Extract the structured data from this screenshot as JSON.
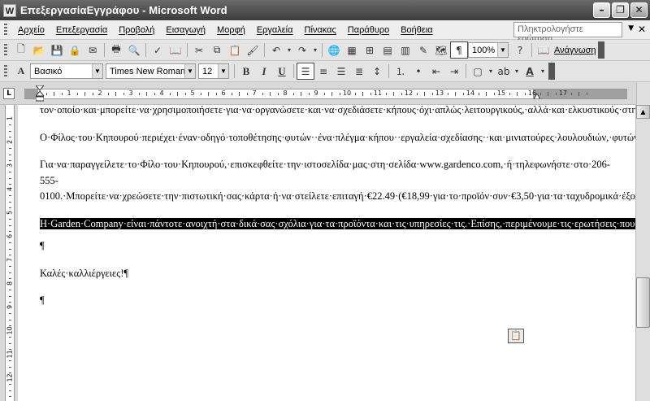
{
  "window": {
    "title": "ΕπεξεργασίαΕγγράφου - Microsoft Word",
    "app_icon_letter": "W"
  },
  "menubar": {
    "items": [
      "Αρχείο",
      "Επεξεργασία",
      "Προβολή",
      "Εισαγωγή",
      "Μορφή",
      "Εργαλεία",
      "Πίνακας",
      "Παράθυρο",
      "Βοήθεια"
    ],
    "ask_placeholder": "Πληκτρολογήστε ερώτηση"
  },
  "standard_toolbar": {
    "zoom": "100%",
    "reading_label": "Ανάγνωση"
  },
  "formatting_toolbar": {
    "style": "Βασικό",
    "font": "Times New Roman",
    "size": "12"
  },
  "ruler": {
    "numbers": [
      "1",
      "2",
      "3",
      "4",
      "5",
      "6",
      "7",
      "8",
      "9",
      "10",
      "11",
      "12",
      "13",
      "14",
      "15",
      "16",
      "17"
    ]
  },
  "vruler": {
    "numbers": [
      "1",
      "2",
      "3",
      "4",
      "5",
      "6",
      "7",
      "8",
      "9",
      "10",
      "11",
      "12"
    ]
  },
  "document": {
    "paragraphs": [
      "τον·οποίο·και·μπορείτε·να·χρησιμοποιήσετε·για·να·οργανώσετε·και·να·σχεδιάσετε·κήπους·όχι·απλώς·λειτουργικούς,·αλλά·και·ελκυστικούς·στην·εμφάνιση.·Το·να·ξέρετε·τι·να·σχεδιάσετε·δεν·αρκεί·από·μόνο·του.·Το·να·ξέρετε·πού·να·το·σχεδιάσετε·ώστε·να·έχετε·τα·καλύτερα·λαχανικά,·λουλούδια,·χόρτα,·και·φρούτα,·είναι·αυτό·που·θα·απογειώσει·την·κηπουρική·σας·σε·ένα·νέο·επίπεδο.¶",
      "Ο·Φίλος·του·Κηπουρού·περιέχει·έναν·οδηγό·τοποθέτησης·φυτών··ένα·πλέγμα·κήπου··εργαλεία·σχεδίασης··και·μινιατούρες·λουλουδιών,·φυτών,·και·βοτάνων,·καθώς·και·ετικέτες·λαχανικών.¶",
      "Για·να·παραγγείλετε·το·Φίλο·του·Κηπουρού,·επισκεφθείτε·την·ιστοσελίδα·μας·στη·σελίδα·www.gardenco.com,·ή·τηλεφωνήστε·στο·206-555-0100.·Μπορείτε·να·χρεώσετε·την·πιστωτική·σας·κάρτα·ή·να·στείλετε·επιταγή·€22.49·(€18,99·για·το·προϊόν·συν·€3,50·για·τα·ταχυδρομικά·έξοδα).¶"
    ],
    "selected_paragraph": "Η·Garden·Company·είναι·πάντοτε·ανοιχτή·στα·δικά·σας·σχόλια·για·τα·προϊόντα·και·τις·υπηρεσίες·τις.·Επίσης,·περιμένουμε·τις·ερωτήσεις·που·πιθανώς·να·έχετε·σχετικά·με·αυτά.·¶",
    "empty_mark": "¶",
    "closing": "Καλές·καλλιέργειες!¶",
    "final_mark": "¶"
  }
}
